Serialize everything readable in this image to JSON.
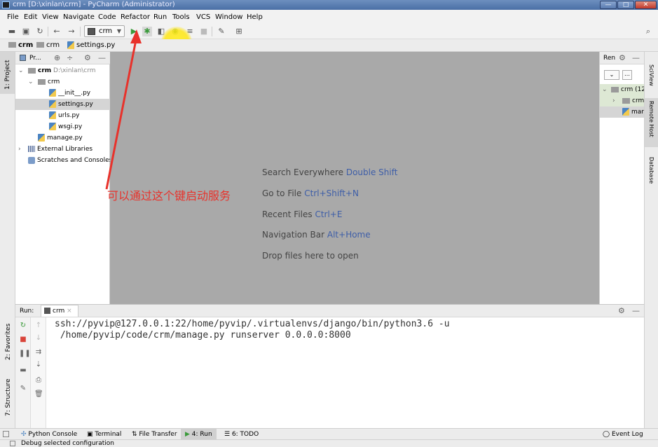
{
  "window": {
    "title": "crm [D:\\xinlan\\crm] - PyCharm (Administrator)"
  },
  "menu": [
    "File",
    "Edit",
    "View",
    "Navigate",
    "Code",
    "Refactor",
    "Run",
    "Tools",
    "VCS",
    "Window",
    "Help"
  ],
  "toolbar": {
    "run_config": "crm"
  },
  "breadcrumb": [
    "crm",
    "crm",
    "settings.py"
  ],
  "left_tools": {
    "project": "1: Project",
    "favorites": "2: Favorites",
    "structure": "7: Structure"
  },
  "project": {
    "header": "Pr...",
    "tree": [
      {
        "label": "crm",
        "extra": "D:\\xinlan\\crm",
        "kind": "folder"
      },
      {
        "label": "crm",
        "extra": "",
        "kind": "folder"
      },
      {
        "label": "__init__.py",
        "extra": "",
        "kind": "py"
      },
      {
        "label": "settings.py",
        "extra": "",
        "kind": "py"
      },
      {
        "label": "urls.py",
        "extra": "",
        "kind": "py"
      },
      {
        "label": "wsgi.py",
        "extra": "",
        "kind": "py"
      },
      {
        "label": "manage.py",
        "extra": "",
        "kind": "py"
      },
      {
        "label": "External Libraries",
        "extra": "",
        "kind": "lib"
      },
      {
        "label": "Scratches and Consoles",
        "extra": "",
        "kind": "scratch"
      }
    ]
  },
  "editor": {
    "hints": [
      {
        "text": "Search Everywhere",
        "key": "Double Shift"
      },
      {
        "text": "Go to File",
        "key": "Ctrl+Shift+N"
      },
      {
        "text": "Recent Files",
        "key": "Ctrl+E"
      },
      {
        "text": "Navigation Bar",
        "key": "Alt+Home"
      },
      {
        "text": "Drop files here to open",
        "key": ""
      }
    ]
  },
  "annotation": {
    "text": "可以通过这个键启动服务",
    "color": "#e8322b"
  },
  "right_panel": {
    "header": "Ren",
    "row1": "crm (12",
    "row2": "crm",
    "row3": "mar"
  },
  "right_tools": {
    "sciview": "SciView",
    "remote_host": "Remote Host",
    "database": "Database"
  },
  "run": {
    "label": "Run:",
    "tab": "crm",
    "console_line1": "ssh://pyvip@127.0.0.1:22/home/pyvip/.virtualenvs/django/bin/python3.6 -u",
    "console_line2": " /home/pyvip/code/crm/manage.py runserver 0.0.0.0:8000"
  },
  "bottom_tabs": [
    "Python Console",
    "Terminal",
    "File Transfer",
    "4: Run",
    "6: TODO"
  ],
  "event_log": "Event Log",
  "status": "Debug selected configuration"
}
